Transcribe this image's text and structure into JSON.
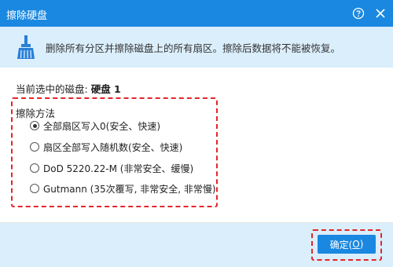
{
  "window": {
    "title": "擦除硬盘",
    "help_icon": "help-circle-icon",
    "close_icon": "close-icon"
  },
  "banner": {
    "icon": "broom-icon",
    "text": "删除所有分区并擦除磁盘上的所有扇区。擦除后数据将不能被恢复。"
  },
  "disk": {
    "label": "当前选中的磁盘:",
    "value": "硬盘 1"
  },
  "methods": {
    "label": "擦除方法",
    "selected_index": 0,
    "options": [
      {
        "label": "全部扇区写入0(安全、快速)",
        "checked": true
      },
      {
        "label": "扇区全部写入随机数(安全、快速)",
        "checked": false
      },
      {
        "label": "DoD 5220.22-M (非常安全、缓慢)",
        "checked": false
      },
      {
        "label": "Gutmann (35次覆写, 非常安全, 非常慢)",
        "checked": false
      }
    ]
  },
  "footer": {
    "ok_text": "确定(",
    "ok_mnemonic": "O",
    "ok_suffix": ")"
  },
  "colors": {
    "titlebar": "#1a88e0",
    "banner": "#daeefc",
    "highlight": "#e2262b",
    "button": "#1a88e0"
  }
}
